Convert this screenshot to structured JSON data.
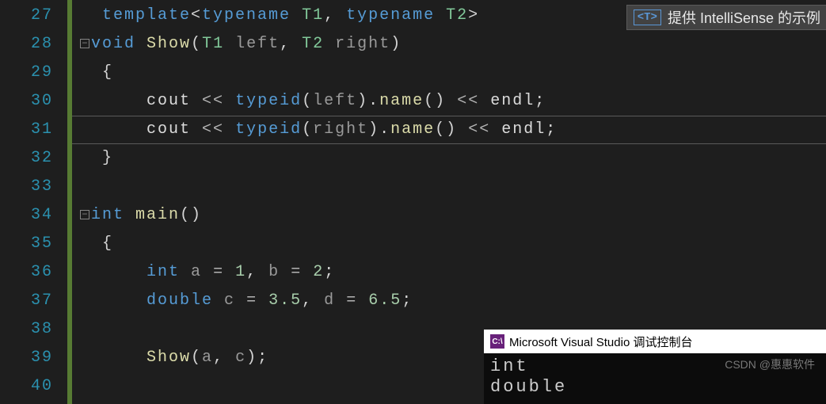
{
  "lineNumbers": [
    "27",
    "28",
    "29",
    "30",
    "31",
    "32",
    "33",
    "34",
    "35",
    "36",
    "37",
    "38",
    "39",
    "40"
  ],
  "hint": {
    "icon": "<T>",
    "text": "提供 IntelliSense 的示例"
  },
  "code": {
    "l27": {
      "kw1": "template",
      "kw2": "typename",
      "tp1": "T1",
      "kw3": "typename",
      "tp2": "T2"
    },
    "l28": {
      "kw": "void",
      "fn": "Show",
      "tp1": "T1",
      "v1": "left",
      "tp2": "T2",
      "v2": "right"
    },
    "l29": {
      "br": "{"
    },
    "l30": {
      "cout": "cout",
      "op": "<<",
      "tid": "typeid",
      "v": "left",
      "name": "name",
      "op2": "<<",
      "endl": "endl"
    },
    "l31": {
      "cout": "cout",
      "op": "<<",
      "tid": "typeid",
      "v": "right",
      "name": "name",
      "op2": "<<",
      "endl": "endl"
    },
    "l32": {
      "br": "}"
    },
    "l34": {
      "kw": "int",
      "fn": "main"
    },
    "l35": {
      "br": "{"
    },
    "l36": {
      "ty": "int",
      "v1": "a",
      "n1": "1",
      "v2": "b",
      "n2": "2"
    },
    "l37": {
      "ty": "double",
      "v1": "c",
      "n1": "3.5",
      "v2": "d",
      "n2": "6.5"
    },
    "l39": {
      "fn": "Show",
      "v1": "a",
      "v2": "c"
    }
  },
  "console": {
    "iconText": "C:\\",
    "title": "Microsoft Visual Studio 调试控制台",
    "out1": "int",
    "out2": "double"
  },
  "watermark": "CSDN @惠惠软件"
}
